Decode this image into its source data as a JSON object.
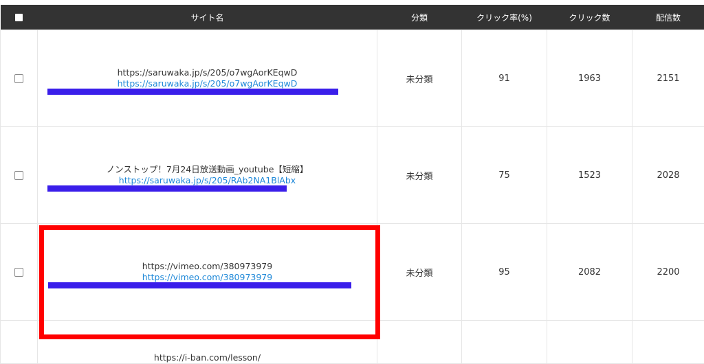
{
  "table": {
    "headers": {
      "site": "サイト名",
      "category": "分類",
      "click_rate": "クリック率(%)",
      "clicks": "クリック数",
      "deliveries": "配信数"
    },
    "rows": [
      {
        "title": "https://saruwaka.jp/s/205/o7wgAorKEqwD",
        "link": "https://saruwaka.jp/s/205/o7wgAorKEqwD",
        "category": "未分類",
        "click_rate": "91",
        "clicks": "1963",
        "deliveries": "2151"
      },
      {
        "title": "ノンストップ！7月24日放送動画_youtube【短縮】",
        "link": "https://saruwaka.jp/s/205/RAb2NA1BlAbx",
        "category": "未分類",
        "click_rate": "75",
        "clicks": "1523",
        "deliveries": "2028"
      },
      {
        "title": "https://vimeo.com/380973979",
        "link": "https://vimeo.com/380973979",
        "category": "未分類",
        "click_rate": "95",
        "clicks": "2082",
        "deliveries": "2200"
      },
      {
        "title": "https://i-ban.com/lesson/"
      }
    ]
  },
  "colors": {
    "header_bg": "#333333",
    "link": "#1e88d8",
    "redaction_bar": "#3a1eea",
    "highlight": "#ff0000"
  }
}
